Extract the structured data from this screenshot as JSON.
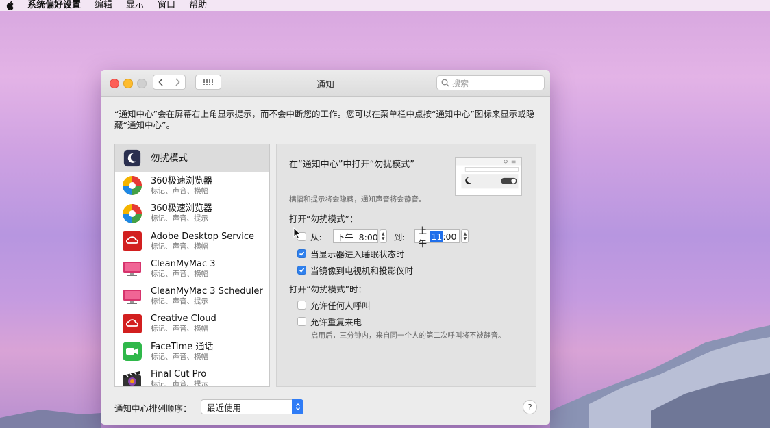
{
  "menubar": {
    "apple_icon": "apple-icon",
    "items": [
      "系统偏好设置",
      "编辑",
      "显示",
      "窗口",
      "帮助"
    ]
  },
  "window": {
    "title": "通知",
    "search_placeholder": "搜索",
    "description": "“通知中心”会在屏幕右上角显示提示，而不会中断您的工作。您可以在菜单栏中点按“通知中心”图标来显示或隐藏“通知中心”。"
  },
  "app_list": [
    {
      "name": "勿扰模式",
      "sub": "",
      "icon": "moon-icon",
      "selected": true
    },
    {
      "name": "360极速浏览器",
      "sub": "标记、声音、横幅",
      "icon": "browser-360-icon"
    },
    {
      "name": "360极速浏览器",
      "sub": "标记、声音、提示",
      "icon": "browser-360-icon"
    },
    {
      "name": "Adobe Desktop Service",
      "sub": "标记、声音、横幅",
      "icon": "adobe-cc-icon"
    },
    {
      "name": "CleanMyMac 3",
      "sub": "标记、声音、横幅",
      "icon": "cleanmymac-icon"
    },
    {
      "name": "CleanMyMac 3 Scheduler",
      "sub": "标记、声音、提示",
      "icon": "cleanmymac-icon"
    },
    {
      "name": "Creative Cloud",
      "sub": "标记、声音、横幅",
      "icon": "adobe-cc-icon"
    },
    {
      "name": "FaceTime 通话",
      "sub": "标记、声音、横幅",
      "icon": "facetime-icon"
    },
    {
      "name": "Final Cut Pro",
      "sub": "标记、声音、提示",
      "icon": "final-cut-icon"
    }
  ],
  "dnd": {
    "title": "在“通知中心”中打开“勿扰模式”",
    "note": "横幅和提示将会隐藏，通知声音将会静音。",
    "schedule_heading": "打开“勿扰模式”：",
    "from_label": "从:",
    "from_time": "下午  8:00",
    "to_label": "到:",
    "to_time_prefix": "上午",
    "to_time_hour": "11",
    "to_time_suffix": ":00",
    "from_checked": false,
    "sleep_label": "当显示器进入睡眠状态时",
    "sleep_checked": true,
    "mirror_label": "当镜像到电视机和投影仪时",
    "mirror_checked": true,
    "when_on_heading": "打开“勿扰模式”时：",
    "allow_calls_label": "允许任何人呼叫",
    "allow_calls_checked": false,
    "repeat_calls_label": "允许重复来电",
    "repeat_calls_checked": false,
    "repeat_note": "启用后，三分钟内，来自同一个人的第二次呼叫将不被静音。"
  },
  "bottom": {
    "sort_label": "通知中心排列顺序：",
    "sort_value": "最近使用",
    "help": "?"
  },
  "colors": {
    "accent": "#2f80ed",
    "close": "#fd5f57",
    "minimize": "#febc2e"
  }
}
